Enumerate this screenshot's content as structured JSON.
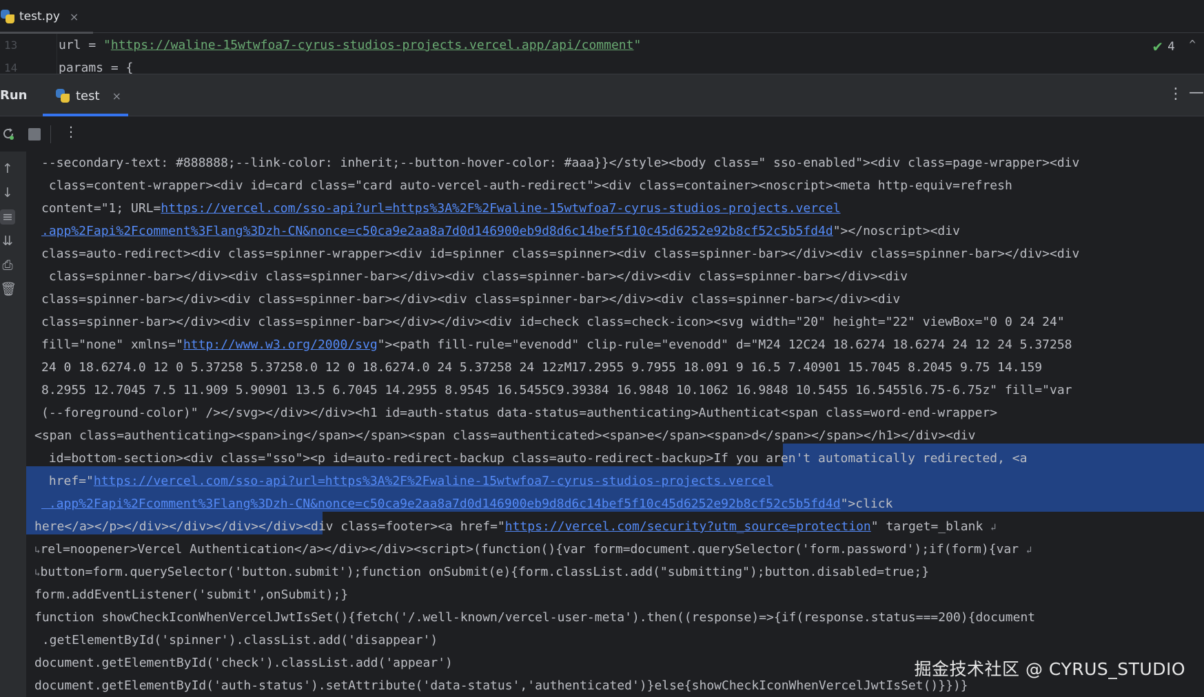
{
  "editor": {
    "tab": {
      "label": "test.py",
      "close": "×"
    },
    "lines": [
      {
        "num": "13",
        "prefix": "url = ",
        "quote_open": "\"",
        "url": "https://waline-15wtwfoa7-cyrus-studios-projects.vercel.app/api/comment",
        "quote_close": "\""
      },
      {
        "num": "14",
        "text": "params = {"
      }
    ],
    "inspection": {
      "check": "✔",
      "count": "4",
      "caret": "^"
    }
  },
  "run": {
    "title": "Run",
    "tab": {
      "label": "test",
      "close": "×"
    },
    "more": "⋮",
    "minimize": "—"
  },
  "toolbar": {
    "more": "⋮"
  },
  "left_strip": {
    "up": "↑",
    "down": "↓",
    "soft_wrap": "≡",
    "scroll_end": "⇊",
    "print": "⎙",
    "trash": "🗑"
  },
  "console": {
    "lines": [
      {
        "parts": [
          {
            "t": "--secondary-text: #888888;--link-color: inherit;--button-hover-color: #aaa}}</style><body class=\" sso-enabled\"><div class=page-wrapper><div"
          }
        ]
      },
      {
        "parts": [
          {
            "t": " class=content-wrapper><div id=card class=\"card auto-vercel-auth-redirect\"><div class=container><noscript><meta http-equiv=refresh"
          }
        ]
      },
      {
        "parts": [
          {
            "t": "content=\"1; URL="
          },
          {
            "t": "https://vercel.com/sso-api?url=https%3A%2F%2Fwaline-15wtwfoa7-cyrus-studios-projects.vercel",
            "link": true
          }
        ]
      },
      {
        "parts": [
          {
            "t": ".app%2Fapi%2Fcomment%3Flang%3Dzh-CN&nonce=c50ca9e2aa8a7d0d146900eb9d8d6c14bef5f10c45d6252e92b8cf52c5b5fd4d",
            "link": true
          },
          {
            "t": "\"></noscript><div"
          }
        ]
      },
      {
        "parts": [
          {
            "t": "class=auto-redirect><div class=spinner-wrapper><div id=spinner class=spinner><div class=spinner-bar></div><div class=spinner-bar></div><div"
          }
        ]
      },
      {
        "parts": [
          {
            "t": " class=spinner-bar></div><div class=spinner-bar></div><div class=spinner-bar></div><div class=spinner-bar></div><div"
          }
        ]
      },
      {
        "parts": [
          {
            "t": "class=spinner-bar></div><div class=spinner-bar></div><div class=spinner-bar></div><div class=spinner-bar></div><div"
          }
        ]
      },
      {
        "parts": [
          {
            "t": "class=spinner-bar></div><div class=spinner-bar></div></div><div id=check class=check-icon><svg width=\"20\" height=\"22\" viewBox=\"0 0 24 24\""
          }
        ]
      },
      {
        "parts": [
          {
            "t": "fill=\"none\" xmlns=\""
          },
          {
            "t": "http://www.w3.org/2000/svg",
            "link": true
          },
          {
            "t": "\"><path fill-rule=\"evenodd\" clip-rule=\"evenodd\" d=\"M24 12C24 18.6274 18.6274 24 12 24 5.37258"
          }
        ]
      },
      {
        "parts": [
          {
            "t": "24 0 18.6274.0 12 0 5.37258 5.37258.0 12 0 18.6274.0 24 5.37258 24 12zM17.2955 9.7955 18.091 9 16.5 7.40901 15.7045 8.2045 9.75 14.159"
          }
        ]
      },
      {
        "parts": [
          {
            "t": "8.2955 12.7045 7.5 11.909 5.90901 13.5 6.7045 14.2955 8.9545 16.5455C9.39384 16.9848 10.1062 16.9848 10.5455 16.5455l6.75-6.75z\" fill=\"var"
          }
        ]
      },
      {
        "parts": [
          {
            "t": "(--foreground-color)\" /></svg></div></div><h1 id=auth-status data-status=authenticating>Authenticat<span class=word-end-wrapper>"
          }
        ]
      },
      {
        "parts": [
          {
            "t": "<span class=authenticating><span>ing</span></span><span class=authenticated><span>e</span><span>d</span></span></h1></div><div"
          }
        ]
      },
      {
        "parts": [
          {
            "t": " id=bottom-section><div class=\"sso\"><p id=auto-redirect-backup class=auto-redirect-backup>"
          },
          {
            "t": "If you aren't automatically redirected, <a"
          }
        ]
      },
      {
        "parts": [
          {
            "t": " href=\""
          },
          {
            "t": "https://vercel.com/sso-api?url=https%3A%2F%2Fwaline-15wtwfoa7-cyrus-studios-projects.vercel",
            "link": true
          }
        ]
      },
      {
        "parts": [
          {
            "t": " .app%2Fapi%2Fcomment%3Flang%3Dzh-CN&nonce=c50ca9e2aa8a7d0d146900eb9d8d6c14bef5f10c45d6252e92b8cf52c5b5fd4d",
            "link": true
          },
          {
            "t": "\">click"
          }
        ]
      },
      {
        "parts": [
          {
            "t": "here</a></p></div></div></div></div>"
          },
          {
            "t": "<div class=footer><a href=\""
          },
          {
            "t": "https://vercel.com/security?utm_source=protection",
            "link": true
          },
          {
            "t": "\" target=_blank "
          },
          {
            "t": "↲",
            "wrap": true
          }
        ]
      },
      {
        "parts": [
          {
            "t": "↳",
            "wrap": true
          },
          {
            "t": "rel=noopener>Vercel Authentication</a></div></div><script>(function(){var form=document.querySelector('form.password');if(form){var "
          },
          {
            "t": "↲",
            "wrap": true
          }
        ]
      },
      {
        "parts": [
          {
            "t": "↳",
            "wrap": true
          },
          {
            "t": "button=form.querySelector('button.submit');function onSubmit(e){form.classList.add(\"submitting\");button.disabled=true;}"
          }
        ]
      },
      {
        "parts": [
          {
            "t": "form.addEventListener('submit',onSubmit);}"
          }
        ]
      },
      {
        "parts": [
          {
            "t": "function showCheckIconWhenVercelJwtIsSet(){fetch('/.well-known/vercel-user-meta').then((response)=>{if(response.status===200){document"
          }
        ]
      },
      {
        "parts": [
          {
            "t": " .getElementById('spinner').classList.add('disappear')"
          }
        ]
      },
      {
        "parts": [
          {
            "t": "document.getElementById('check').classList.add('appear')"
          }
        ]
      },
      {
        "parts": [
          {
            "t": "document.getElementById('auth-status').setAttribute('data-status','authenticated')}else{showCheckIconWhenVercelJwtIsSet()}})}"
          }
        ]
      }
    ]
  },
  "watermark": "掘金技术社区 @ CYRUS_STUDIO",
  "colors": {
    "background": "#1e1f22",
    "panel": "#2b2d30",
    "text": "#bcbec4",
    "string": "#6aab73",
    "link": "#548af7",
    "selection": "#214283",
    "accent": "#3574f0",
    "check": "#5fb865"
  }
}
